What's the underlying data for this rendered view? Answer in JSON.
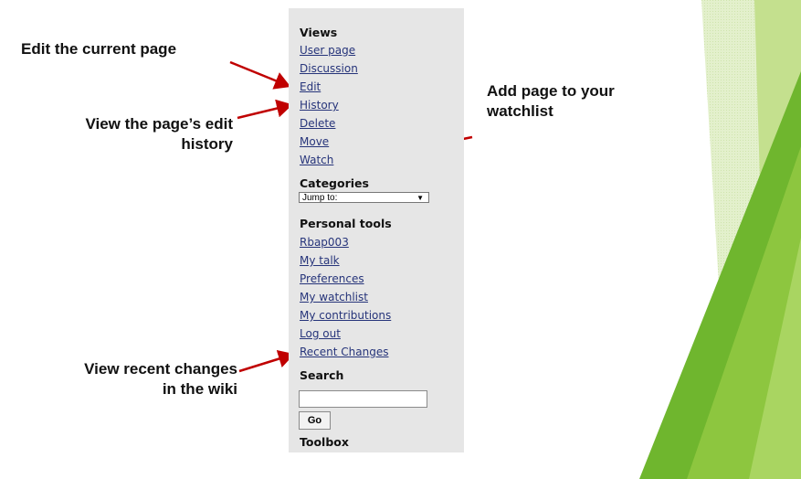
{
  "callouts": {
    "edit": "Edit the current page",
    "history_line1": "View the page’s edit",
    "history_line2": "history",
    "watch_line1": "Add page to your",
    "watch_line2": "watchlist",
    "recent_line1": "View recent changes",
    "recent_line2": "in the wiki"
  },
  "sidebar": {
    "views_heading": "Views",
    "views": [
      "User page",
      "Discussion",
      "Edit",
      "History",
      "Delete",
      "Move",
      "Watch"
    ],
    "categories_heading": "Categories",
    "jump_select_value": "Jump to:",
    "personal_heading": "Personal tools",
    "personal": [
      "Rbap003",
      "My talk",
      "Preferences",
      "My watchlist",
      "My contributions",
      "Log out",
      "Recent Changes"
    ],
    "search_heading": "Search",
    "search_value": "",
    "go_label": "Go",
    "toolbox_heading": "Toolbox"
  },
  "colors": {
    "arrow": "#c00000",
    "link": "#26347a",
    "panel": "#e6e6e6",
    "accent_green": "#8dc63f"
  }
}
